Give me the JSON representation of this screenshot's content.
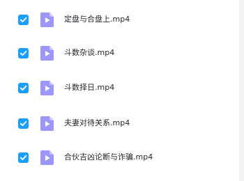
{
  "files": [
    {
      "name": "定盘与合盘上.mp4",
      "checked": true,
      "icon": "video-file-icon"
    },
    {
      "name": "斗数杂谈.mp4",
      "checked": true,
      "icon": "video-file-icon"
    },
    {
      "name": "斗数择日.mp4",
      "checked": true,
      "icon": "video-file-icon"
    },
    {
      "name": "夫妻对待关系.mp4",
      "checked": true,
      "icon": "video-file-icon"
    },
    {
      "name": "合伙吉凶论断与诈骗.mp4",
      "checked": true,
      "icon": "video-file-icon"
    }
  ],
  "colors": {
    "checkbox": "#1a9fff",
    "file_icon": "#9c97ff",
    "text": "#25262b"
  }
}
